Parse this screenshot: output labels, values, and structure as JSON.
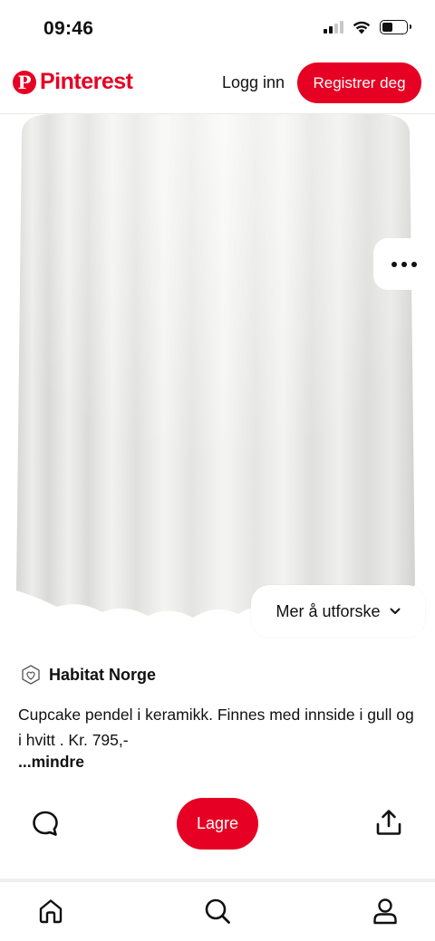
{
  "status_bar": {
    "time": "09:46",
    "icons": [
      "signal-icon",
      "wifi-icon",
      "battery-icon"
    ],
    "battery_level": 0.45
  },
  "header": {
    "logo_text": "Pinterest",
    "logo_mark": "P",
    "login_label": "Logg inn",
    "register_label": "Registrer deg",
    "brand_color": "#e60023"
  },
  "pin": {
    "more_icon": "more-dots-icon",
    "explore_label": "Mer å utforske",
    "explore_icon": "chevron-down-icon"
  },
  "details": {
    "source_icon": "source-logo-icon",
    "source_name": "Habitat Norge",
    "description": "Cupcake pendel i keramikk. Finnes med innside i gull og i hvitt . Kr. 795,-",
    "less_label": "...mindre"
  },
  "actions": {
    "comment_icon": "comment-icon",
    "save_label": "Lagre",
    "share_icon": "share-icon"
  },
  "bottom_nav": {
    "items": [
      "home-icon",
      "search-icon",
      "profile-icon"
    ]
  }
}
